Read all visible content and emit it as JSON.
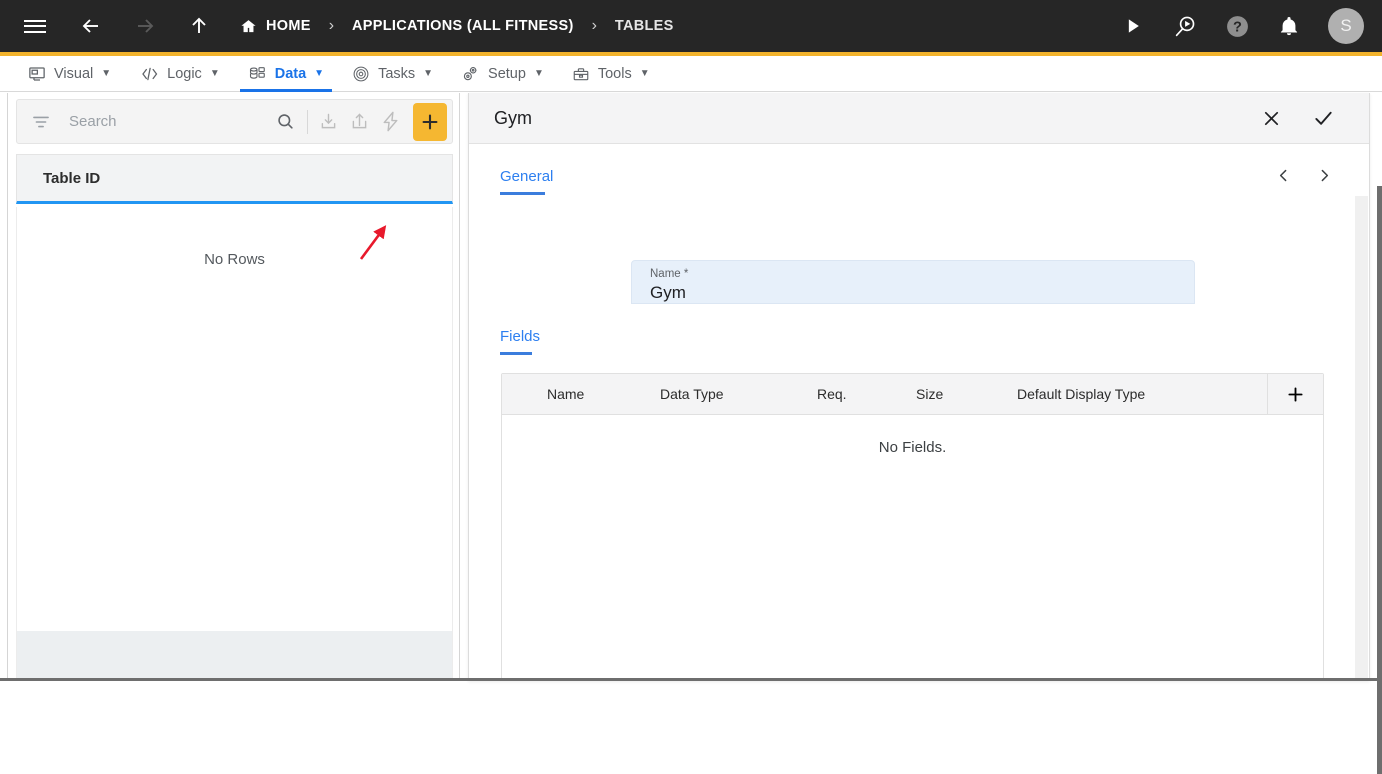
{
  "topbar": {
    "menu_icon": "hamburger-icon",
    "back_icon": "arrow-left-icon",
    "forward_icon": "arrow-right-icon",
    "up_icon": "arrow-up-icon",
    "breadcrumbs": [
      {
        "label": "HOME",
        "icon": "home-icon"
      },
      {
        "label": "APPLICATIONS (ALL FITNESS)",
        "icon": ""
      },
      {
        "label": "TABLES",
        "icon": ""
      }
    ],
    "separator": "›",
    "actions": [
      {
        "name": "run-icon",
        "glyph": "▶"
      },
      {
        "name": "search-run-icon",
        "glyph": ""
      },
      {
        "name": "help-icon",
        "glyph": "?"
      },
      {
        "name": "notifications-bell-icon",
        "glyph": ""
      }
    ],
    "avatar_initial": "S",
    "accent_color": "#f2b32c"
  },
  "menubar": {
    "items": [
      {
        "label": "Visual",
        "icon": "monitor-icon",
        "active": false
      },
      {
        "label": "Logic",
        "icon": "code-brackets-icon",
        "active": false
      },
      {
        "label": "Data",
        "icon": "database-icon",
        "active": true
      },
      {
        "label": "Tasks",
        "icon": "target-icon",
        "active": false
      },
      {
        "label": "Setup",
        "icon": "gears-icon",
        "active": false
      },
      {
        "label": "Tools",
        "icon": "toolbox-icon",
        "active": false
      }
    ],
    "caret": "▼",
    "active_color": "#1a73e8"
  },
  "left_panel": {
    "search": {
      "placeholder": "Search",
      "value": ""
    },
    "toolbar_icons": [
      {
        "name": "filter-icon"
      },
      {
        "name": "search-icon"
      },
      {
        "name": "import-icon"
      },
      {
        "name": "export-icon"
      },
      {
        "name": "lightning-bolt-icon"
      }
    ],
    "add_button": {
      "label": "+",
      "color": "#f5b731"
    },
    "column_header": "Table ID",
    "empty_text": "No Rows",
    "header_underline_color": "#2196f3"
  },
  "annotation": {
    "arrow_color": "#e8192c",
    "points_at": "lightning-bolt-icon"
  },
  "right_panel": {
    "title": "Gym",
    "close_label": "✕",
    "confirm_label": "✓",
    "tab": "General",
    "prev_label": "‹",
    "next_label": "›",
    "name_field": {
      "label": "Name *",
      "value": "Gym"
    },
    "fields_section": {
      "tab": "Fields",
      "columns": [
        "Name",
        "Data Type",
        "Req.",
        "Size",
        "Default Display Type"
      ],
      "add_label": "+",
      "rows": [],
      "empty_text": "No Fields."
    }
  }
}
